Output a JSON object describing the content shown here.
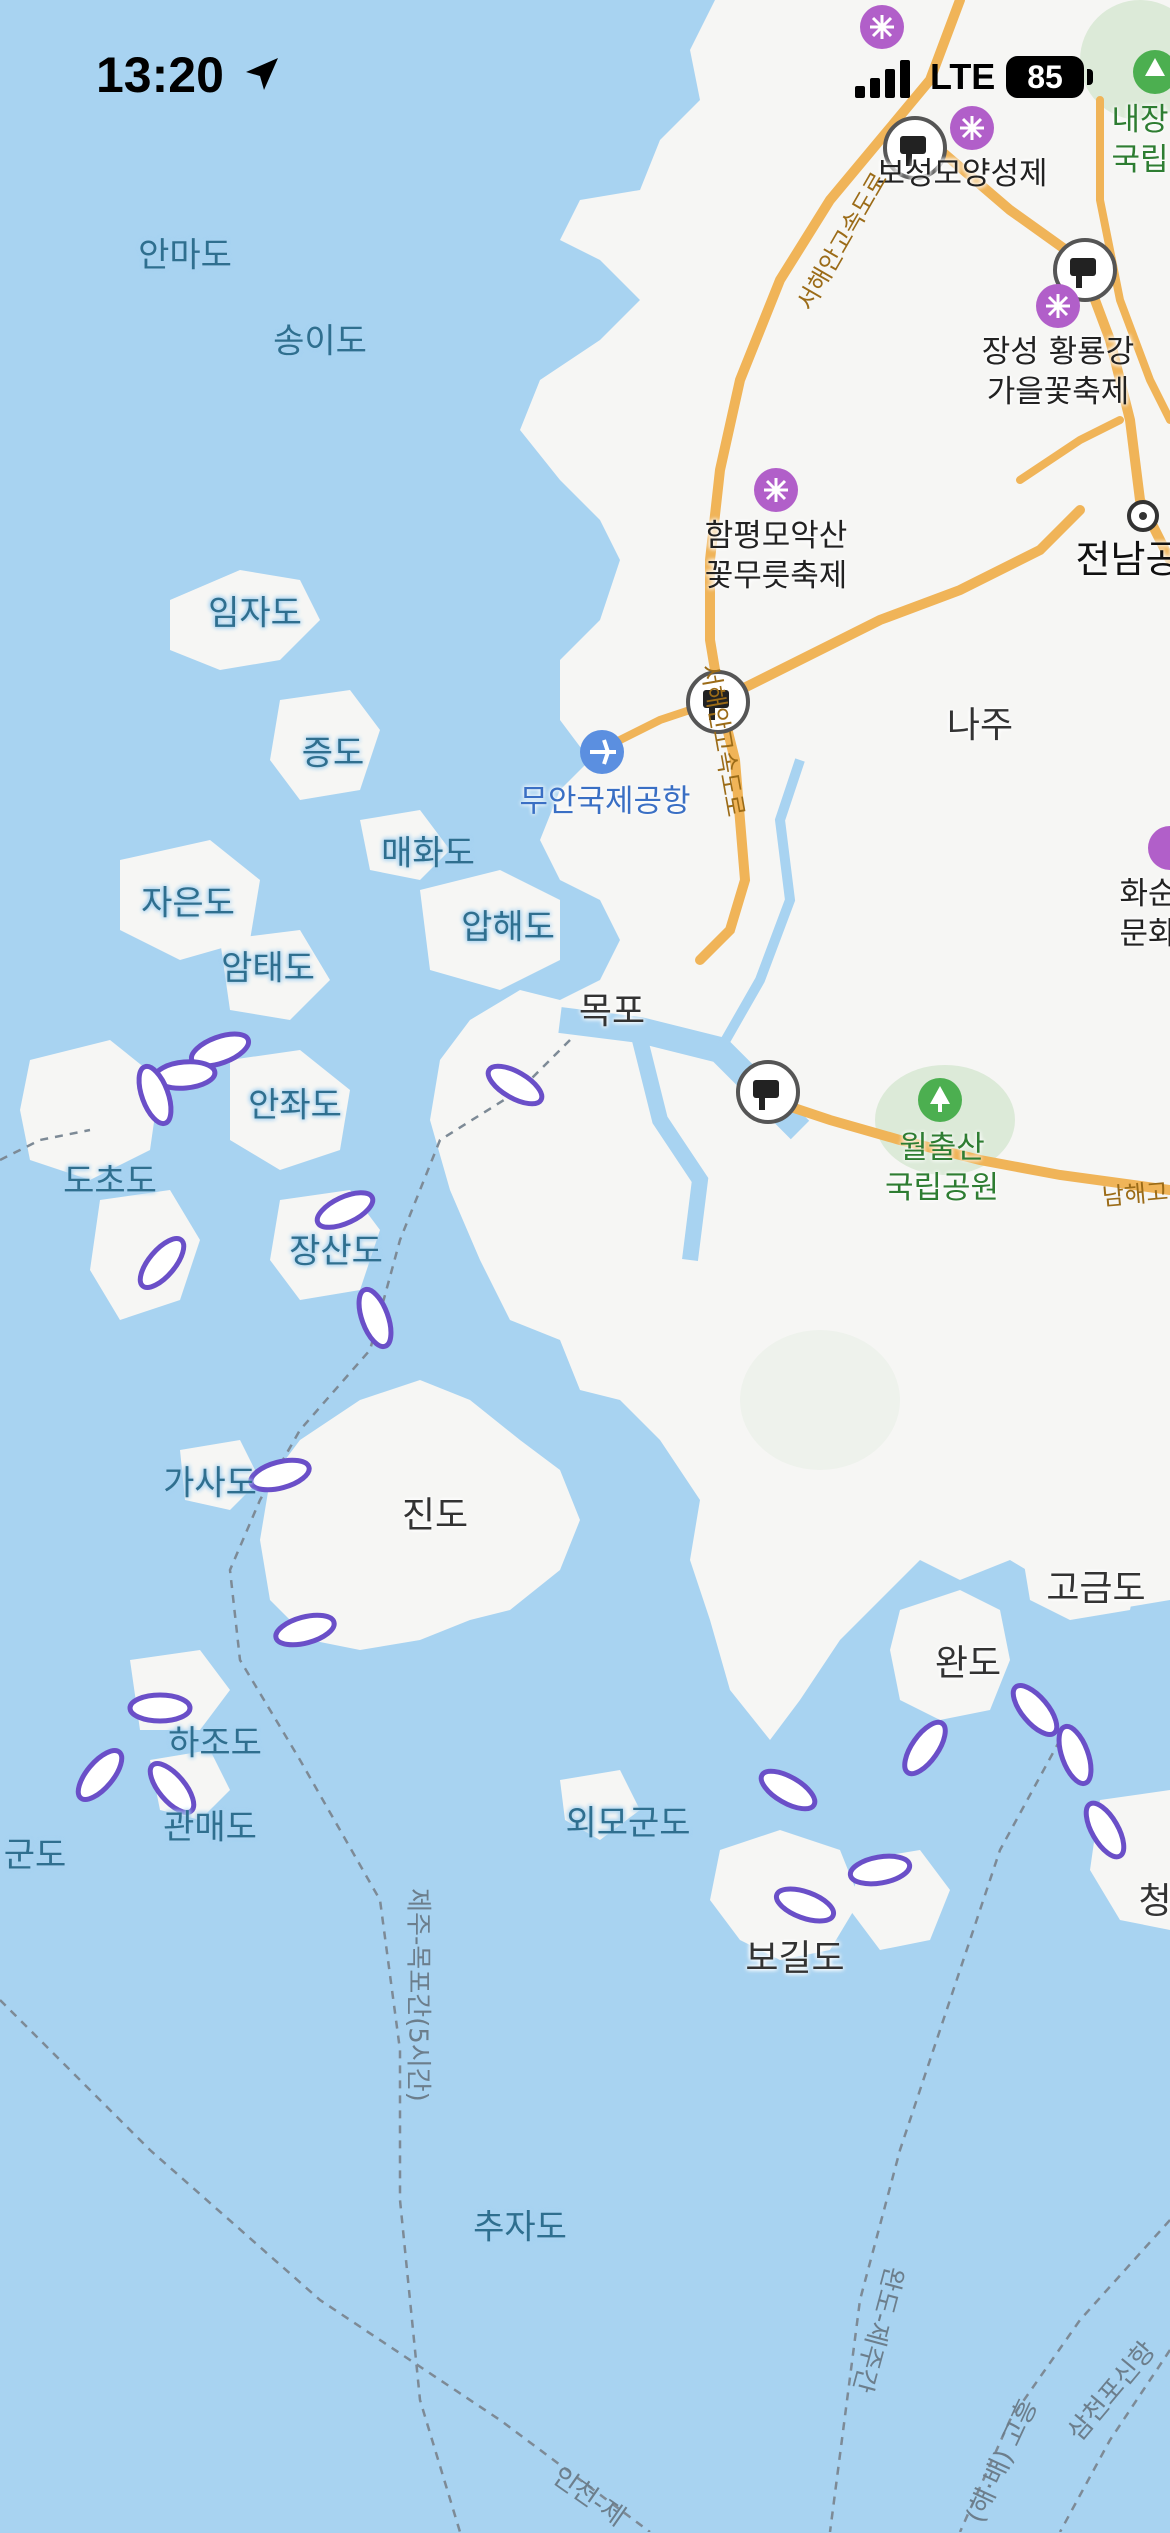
{
  "status_bar": {
    "time": "13:20",
    "network": "LTE",
    "battery": "85"
  },
  "map": {
    "sea_labels": [
      "안마도",
      "송이도",
      "임자도",
      "증도",
      "매화도",
      "자은도",
      "압해도",
      "암태도",
      "안좌도",
      "도초도",
      "장산도",
      "가사도",
      "하조도",
      "관매도",
      "외모군도",
      "추자도",
      "군도"
    ],
    "land_labels": [
      "진도",
      "완도",
      "보길도",
      "고금도",
      "목포",
      "나주",
      "전남공",
      "청"
    ],
    "poi_labels": [
      "함평모악산\n꽃무릇축제",
      "장성 황룡강\n가을꽃축제",
      "보성모양성제",
      "화순\n문화"
    ],
    "park_labels": [
      "월출산\n국립공원",
      "내장\n국립"
    ],
    "airport": "무안국제공항",
    "ferry_routes": [
      "제주-목포간(5시간)",
      "완도-제주간",
      "삼천포신항",
      "인천-제",
      "(해·배) 고흥"
    ],
    "highways": [
      "서해안고속도로",
      "서해안고속도로",
      "남해고"
    ]
  },
  "colors": {
    "sea": "#a8d3f1",
    "land": "#f6f6f4",
    "highway": "#f0b458",
    "ferry_icon": "#6a4fc8",
    "festival": "#b15fc9"
  }
}
